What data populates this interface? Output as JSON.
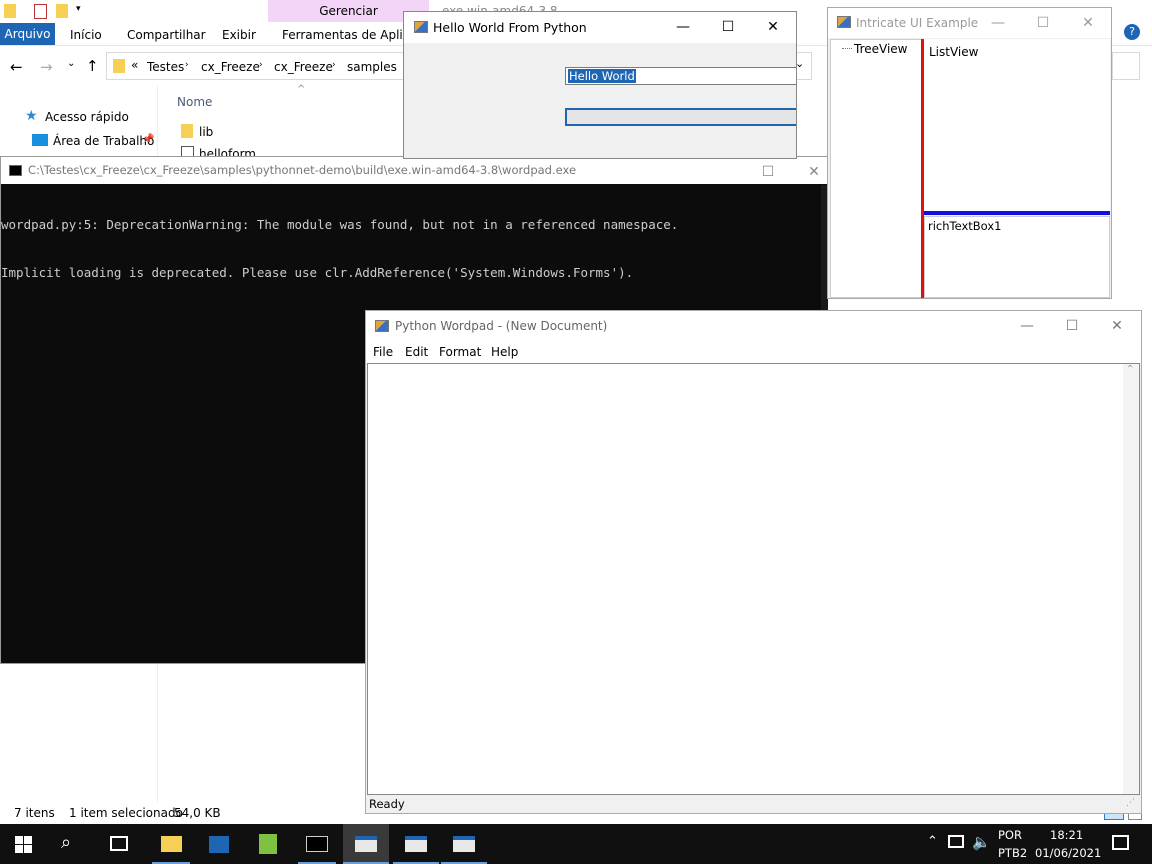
{
  "explorer": {
    "qat_title": "exe.win-amd64-3.8",
    "manage_tab": "Gerenciar",
    "ribbon_tabs": [
      "Arquivo",
      "Início",
      "Compartilhar",
      "Exibir",
      "Ferramentas de Aplicativo"
    ],
    "breadcrumb_prefix": "«",
    "breadcrumb": [
      "Testes",
      "cx_Freeze",
      "cx_Freeze",
      "samples"
    ],
    "sidebar_quick": "Acesso rápido",
    "sidebar_desktop": "Área de Trabalho",
    "col_name": "Nome",
    "files": [
      "lib",
      "helloform"
    ],
    "status_items": "7 itens",
    "status_selected": "1 item selecionado",
    "status_size": "54,0 KB"
  },
  "hello": {
    "title": "Hello World From Python",
    "textbox_value": "Hello World"
  },
  "intricate": {
    "title": "Intricate UI Example",
    "tree_node": "TreeView",
    "listview": "ListView",
    "richtext": "richTextBox1"
  },
  "console": {
    "title": "C:\\Testes\\cx_Freeze\\cx_Freeze\\samples\\pythonnet-demo\\build\\exe.win-amd64-3.8\\wordpad.exe",
    "line1": "wordpad.py:5: DeprecationWarning: The module was found, but not in a referenced namespace.",
    "line2": "Implicit loading is deprecated. Please use clr.AddReference('System.Windows.Forms')."
  },
  "wordpad": {
    "title": "Python Wordpad - (New Document)",
    "menu": [
      "File",
      "Edit",
      "Format",
      "Help"
    ],
    "status": "Ready"
  },
  "taskbar": {
    "lang1": "POR",
    "lang2": "PTB2",
    "time": "18:21",
    "date": "01/06/2021"
  },
  "colors": {
    "accent": "#1e66b4",
    "manage_tab_bg": "#f3d5f7",
    "console_bg": "#0c0c0c",
    "taskbar_bg": "#101010",
    "splitter_red": "#e01010",
    "splitter_blue": "#1010e0"
  }
}
